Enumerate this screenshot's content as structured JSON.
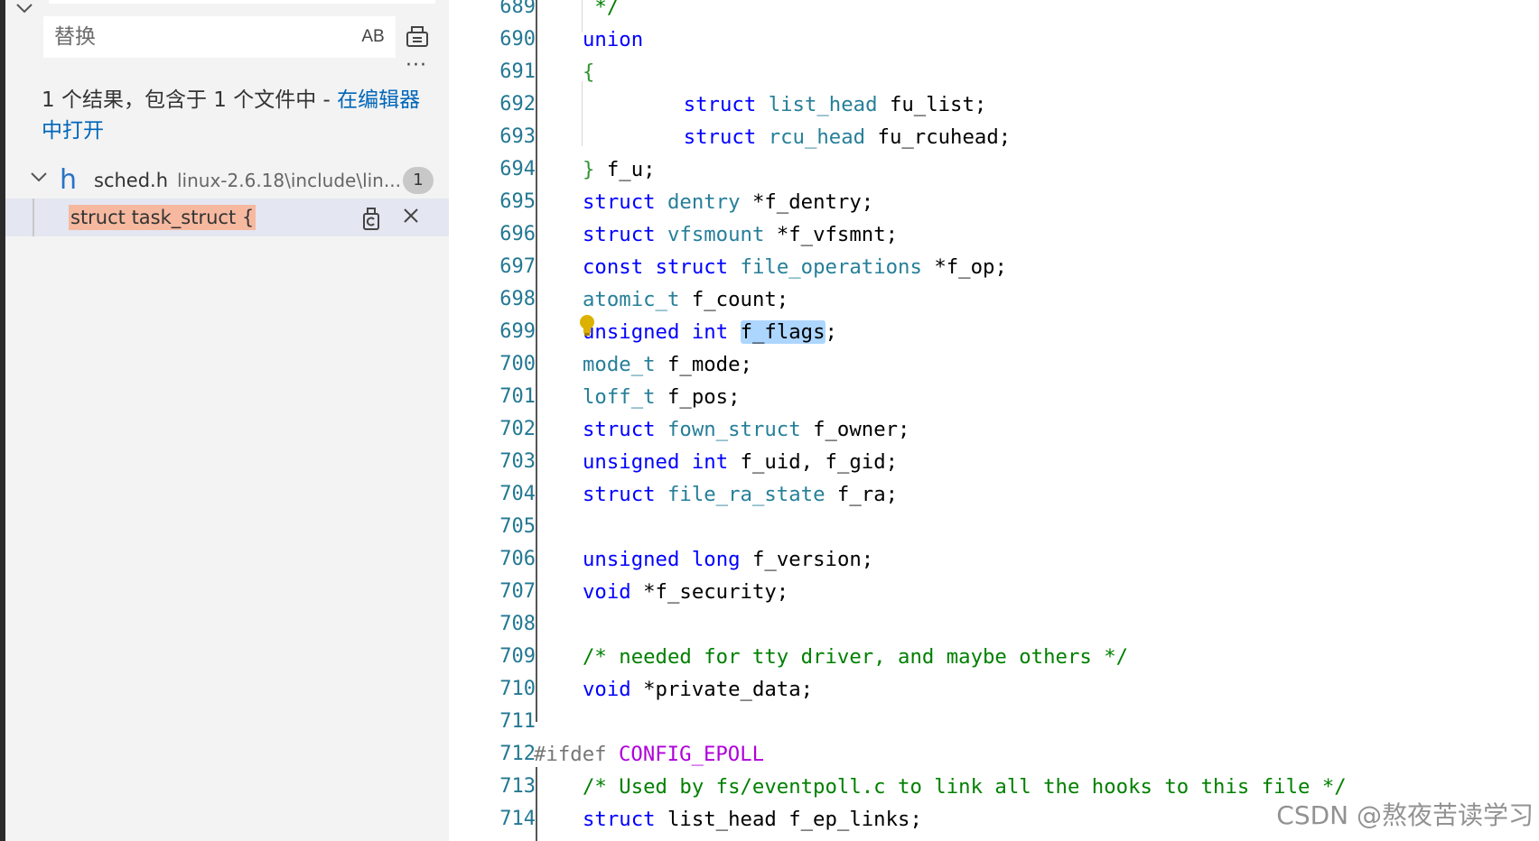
{
  "search_panel": {
    "replace_placeholder": "替换",
    "preserve_case_label": "AB",
    "more_label": "···",
    "summary_text": "1 个结果，包含于 1 个文件中 - ",
    "summary_link": "在编辑器中打开",
    "file": {
      "icon_letter": "h",
      "name": "sched.h",
      "path": "linux-2.6.18\\include\\lin...",
      "match_count": "1"
    },
    "match": {
      "text": "struct task_struct {"
    }
  },
  "editor": {
    "lines": [
      {
        "n": "689",
        "tokens": [
          {
            "t": "comment",
            "v": " */"
          }
        ]
      },
      {
        "n": "690",
        "tokens": [
          {
            "t": "kw",
            "v": "union"
          }
        ]
      },
      {
        "n": "691",
        "tokens": [
          {
            "t": "brace",
            "v": "{"
          }
        ]
      },
      {
        "n": "692",
        "tokens": [
          {
            "t": "ws",
            "v": "    "
          },
          {
            "t": "kw",
            "v": "struct"
          },
          {
            "t": "ws",
            "v": " "
          },
          {
            "t": "type",
            "v": "list_head"
          },
          {
            "t": "id",
            "v": " fu_list;"
          }
        ]
      },
      {
        "n": "693",
        "tokens": [
          {
            "t": "ws",
            "v": "    "
          },
          {
            "t": "kw",
            "v": "struct"
          },
          {
            "t": "ws",
            "v": " "
          },
          {
            "t": "type",
            "v": "rcu_head"
          },
          {
            "t": "id",
            "v": " fu_rcuhead;"
          }
        ]
      },
      {
        "n": "694",
        "tokens": [
          {
            "t": "brace",
            "v": "}"
          },
          {
            "t": "id",
            "v": " f_u;"
          }
        ]
      },
      {
        "n": "695",
        "tokens": [
          {
            "t": "kw",
            "v": "struct"
          },
          {
            "t": "ws",
            "v": " "
          },
          {
            "t": "type",
            "v": "dentry"
          },
          {
            "t": "id",
            "v": " *f_dentry;"
          }
        ]
      },
      {
        "n": "696",
        "tokens": [
          {
            "t": "kw",
            "v": "struct"
          },
          {
            "t": "ws",
            "v": " "
          },
          {
            "t": "type",
            "v": "vfsmount"
          },
          {
            "t": "id",
            "v": " *f_vfsmnt;"
          }
        ]
      },
      {
        "n": "697",
        "tokens": [
          {
            "t": "kw",
            "v": "const"
          },
          {
            "t": "ws",
            "v": " "
          },
          {
            "t": "kw",
            "v": "struct"
          },
          {
            "t": "ws",
            "v": " "
          },
          {
            "t": "type",
            "v": "file_operations"
          },
          {
            "t": "id",
            "v": " *f_op;"
          }
        ]
      },
      {
        "n": "698",
        "tokens": [
          {
            "t": "type",
            "v": "atomic_t"
          },
          {
            "t": "id",
            "v": " f_count;"
          }
        ]
      },
      {
        "n": "699",
        "tokens": [
          {
            "t": "kw",
            "v": "unsigned"
          },
          {
            "t": "ws",
            "v": " "
          },
          {
            "t": "kw",
            "v": "int"
          },
          {
            "t": "ws",
            "v": " "
          },
          {
            "t": "hl",
            "v": "f_flags"
          },
          {
            "t": "id",
            "v": ";"
          }
        ]
      },
      {
        "n": "700",
        "tokens": [
          {
            "t": "type",
            "v": "mode_t"
          },
          {
            "t": "id",
            "v": " f_mode;"
          }
        ]
      },
      {
        "n": "701",
        "tokens": [
          {
            "t": "type",
            "v": "loff_t"
          },
          {
            "t": "id",
            "v": " f_pos;"
          }
        ]
      },
      {
        "n": "702",
        "tokens": [
          {
            "t": "kw",
            "v": "struct"
          },
          {
            "t": "ws",
            "v": " "
          },
          {
            "t": "type",
            "v": "fown_struct"
          },
          {
            "t": "id",
            "v": " f_owner;"
          }
        ]
      },
      {
        "n": "703",
        "tokens": [
          {
            "t": "kw",
            "v": "unsigned"
          },
          {
            "t": "ws",
            "v": " "
          },
          {
            "t": "kw",
            "v": "int"
          },
          {
            "t": "id",
            "v": " f_uid, f_gid;"
          }
        ]
      },
      {
        "n": "704",
        "tokens": [
          {
            "t": "kw",
            "v": "struct"
          },
          {
            "t": "ws",
            "v": " "
          },
          {
            "t": "type",
            "v": "file_ra_state"
          },
          {
            "t": "id",
            "v": " f_ra;"
          }
        ]
      },
      {
        "n": "705",
        "tokens": []
      },
      {
        "n": "706",
        "tokens": [
          {
            "t": "kw",
            "v": "unsigned"
          },
          {
            "t": "ws",
            "v": " "
          },
          {
            "t": "kw",
            "v": "long"
          },
          {
            "t": "id",
            "v": " f_version;"
          }
        ]
      },
      {
        "n": "707",
        "tokens": [
          {
            "t": "kw",
            "v": "void"
          },
          {
            "t": "id",
            "v": " *f_security;"
          }
        ]
      },
      {
        "n": "708",
        "tokens": []
      },
      {
        "n": "709",
        "tokens": [
          {
            "t": "comment",
            "v": "/* needed for tty driver, and maybe others */"
          }
        ]
      },
      {
        "n": "710",
        "tokens": [
          {
            "t": "kw",
            "v": "void"
          },
          {
            "t": "id",
            "v": " *private_data;"
          }
        ]
      },
      {
        "n": "711",
        "tokens": []
      },
      {
        "n": "712",
        "tokens": [
          {
            "t": "pre",
            "v": "#ifdef"
          },
          {
            "t": "ws",
            "v": " "
          },
          {
            "t": "macro",
            "v": "CONFIG_EPOLL"
          }
        ]
      },
      {
        "n": "713",
        "tokens": [
          {
            "t": "comment",
            "v": "/* Used by fs/eventpoll.c to link all the hooks to this file */"
          }
        ]
      },
      {
        "n": "714",
        "tokens": [
          {
            "t": "kw",
            "v": "struct"
          },
          {
            "t": "id",
            "v": " list_head f_ep_links;"
          }
        ]
      }
    ]
  },
  "watermark": "CSDN @熬夜苦读学习"
}
